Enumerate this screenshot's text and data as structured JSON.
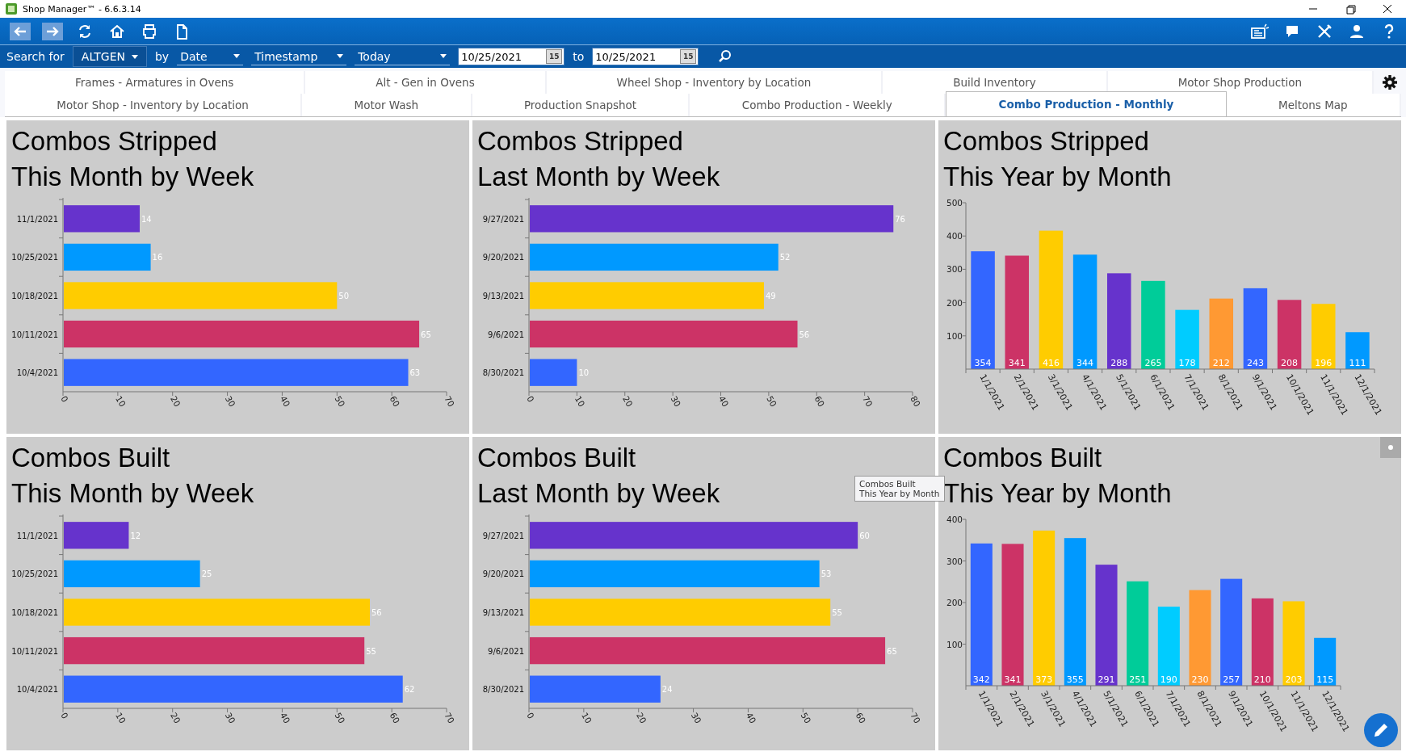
{
  "window": {
    "title": "Shop Manager™ - 6.6.3.14"
  },
  "search": {
    "label": "Search for",
    "customer": "ALTGEN",
    "by_label": "by",
    "field": "Date",
    "timestamp": "Timestamp",
    "range": "Today",
    "from_date": "10/25/2021",
    "from_calendar": "15",
    "to_label": "to",
    "to_date": "10/25/2021",
    "to_calendar": "15"
  },
  "tabs": [
    [
      {
        "label": "Frames - Armatures in Ovens",
        "selected": false
      },
      {
        "label": "Alt - Gen in Ovens",
        "selected": false
      },
      {
        "label": "Wheel Shop - Inventory by Location",
        "selected": false
      },
      {
        "label": "Build Inventory",
        "selected": false
      },
      {
        "label": "Motor Shop Production",
        "selected": false
      }
    ],
    [
      {
        "label": "Motor Shop - Inventory by Location",
        "selected": false
      },
      {
        "label": "Motor Wash",
        "selected": false
      },
      {
        "label": "Production Snapshot",
        "selected": false
      },
      {
        "label": "Combo Production - Weekly",
        "selected": false
      },
      {
        "label": "Combo Production - Monthly",
        "selected": true
      },
      {
        "label": "Meltons Map",
        "selected": false
      }
    ]
  ],
  "panels": [
    {
      "title_lines": [
        "Combos Stripped",
        "This Month by Week"
      ],
      "bars": [
        {
          "color": "#6633cc"
        },
        {
          "color": "#0099ff"
        },
        {
          "color": "#ffcc00"
        },
        {
          "color": "#cc3366"
        },
        {
          "color": "#3366ff"
        }
      ],
      "chart_data": {
        "type": "bar",
        "orientation": "horizontal",
        "categories": [
          "11/1/2021",
          "10/25/2021",
          "10/18/2021",
          "10/11/2021",
          "10/4/2021"
        ],
        "series": [
          {
            "values": [
              14,
              16,
              50,
              65,
              63
            ]
          }
        ],
        "xlim": [
          0,
          70
        ],
        "xticks": [
          0,
          10,
          20,
          30,
          40,
          50,
          60,
          70
        ],
        "data_labels": true
      }
    },
    {
      "title_lines": [
        "Combos Stripped",
        "Last Month by Week"
      ],
      "bars": [
        {
          "color": "#6633cc"
        },
        {
          "color": "#0099ff"
        },
        {
          "color": "#ffcc00"
        },
        {
          "color": "#cc3366"
        },
        {
          "color": "#3366ff"
        }
      ],
      "chart_data": {
        "type": "bar",
        "orientation": "horizontal",
        "categories": [
          "9/27/2021",
          "9/20/2021",
          "9/13/2021",
          "9/6/2021",
          "8/30/2021"
        ],
        "series": [
          {
            "values": [
              76,
              52,
              49,
              56,
              10
            ]
          }
        ],
        "xlim": [
          0,
          80
        ],
        "xticks": [
          0,
          10,
          20,
          30,
          40,
          50,
          60,
          70,
          80
        ],
        "data_labels": true
      }
    },
    {
      "title_lines": [
        "Combos Stripped",
        "This Year by Month"
      ],
      "bars": [
        {
          "color": "#3366ff"
        },
        {
          "color": "#cc3366"
        },
        {
          "color": "#ffcc00"
        },
        {
          "color": "#0099ff"
        },
        {
          "color": "#6633cc"
        },
        {
          "color": "#00cc99"
        },
        {
          "color": "#00ccff"
        },
        {
          "color": "#ff9933"
        },
        {
          "color": "#3366ff"
        },
        {
          "color": "#cc3366"
        },
        {
          "color": "#ffcc00"
        },
        {
          "color": "#0099ff"
        }
      ],
      "chart_data": {
        "type": "bar",
        "orientation": "vertical",
        "categories": [
          "1/1/2021",
          "2/1/2021",
          "3/1/2021",
          "4/1/2021",
          "5/1/2021",
          "6/1/2021",
          "7/1/2021",
          "8/1/2021",
          "9/1/2021",
          "10/1/2021",
          "11/1/2021",
          "12/1/2021"
        ],
        "series": [
          {
            "values": [
              354,
              341,
              416,
              344,
              288,
              265,
              178,
              212,
              243,
              208,
              196,
              111
            ]
          }
        ],
        "ylim": [
          0,
          500
        ],
        "yticks": [
          100,
          200,
          300,
          400,
          500
        ],
        "data_labels": true
      }
    },
    {
      "title_lines": [
        "Combos Built",
        "This Month by Week"
      ],
      "bars": [
        {
          "color": "#6633cc"
        },
        {
          "color": "#0099ff"
        },
        {
          "color": "#ffcc00"
        },
        {
          "color": "#cc3366"
        },
        {
          "color": "#3366ff"
        }
      ],
      "chart_data": {
        "type": "bar",
        "orientation": "horizontal",
        "categories": [
          "11/1/2021",
          "10/25/2021",
          "10/18/2021",
          "10/11/2021",
          "10/4/2021"
        ],
        "series": [
          {
            "values": [
              12,
              25,
              56,
              55,
              62
            ]
          }
        ],
        "xlim": [
          0,
          70
        ],
        "xticks": [
          0,
          10,
          20,
          30,
          40,
          50,
          60,
          70
        ],
        "data_labels": true
      }
    },
    {
      "title_lines": [
        "Combos Built",
        "Last Month by Week"
      ],
      "bars": [
        {
          "color": "#6633cc"
        },
        {
          "color": "#0099ff"
        },
        {
          "color": "#ffcc00"
        },
        {
          "color": "#cc3366"
        },
        {
          "color": "#3366ff"
        }
      ],
      "chart_data": {
        "type": "bar",
        "orientation": "horizontal",
        "categories": [
          "9/27/2021",
          "9/20/2021",
          "9/13/2021",
          "9/6/2021",
          "8/30/2021"
        ],
        "series": [
          {
            "values": [
              60,
              53,
              55,
              65,
              24
            ]
          }
        ],
        "xlim": [
          0,
          70
        ],
        "xticks": [
          0,
          10,
          20,
          30,
          40,
          50,
          60,
          70
        ],
        "data_labels": true
      }
    },
    {
      "title_lines": [
        "Combos Built",
        "This Year by Month"
      ],
      "bars": [
        {
          "color": "#3366ff"
        },
        {
          "color": "#cc3366"
        },
        {
          "color": "#ffcc00"
        },
        {
          "color": "#0099ff"
        },
        {
          "color": "#6633cc"
        },
        {
          "color": "#00cc99"
        },
        {
          "color": "#00ccff"
        },
        {
          "color": "#ff9933"
        },
        {
          "color": "#3366ff"
        },
        {
          "color": "#cc3366"
        },
        {
          "color": "#ffcc00"
        },
        {
          "color": "#0099ff"
        }
      ],
      "chart_data": {
        "type": "bar",
        "orientation": "vertical",
        "categories": [
          "1/1/2021",
          "2/1/2021",
          "3/1/2021",
          "4/1/2021",
          "5/1/2021",
          "6/1/2021",
          "7/1/2021",
          "8/1/2021",
          "9/1/2021",
          "10/1/2021",
          "11/1/2021",
          "12/1/2021"
        ],
        "series": [
          {
            "values": [
              342,
              341,
              373,
              355,
              291,
              251,
              190,
              230,
              257,
              210,
              203,
              115
            ]
          }
        ],
        "ylim": [
          0,
          400
        ],
        "yticks": [
          100,
          200,
          300,
          400
        ],
        "data_labels": true
      },
      "tooltip_lines": [
        "Combos Built",
        "This Year by Month"
      ]
    }
  ]
}
